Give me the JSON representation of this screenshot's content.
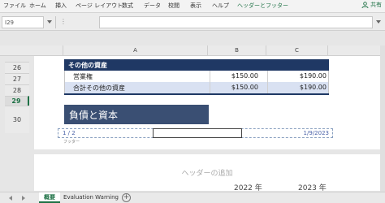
{
  "ribbon": {
    "tabs": [
      "ファイル",
      "ホーム",
      "挿入",
      "ページ レイアウト",
      "数式",
      "データ",
      "校閲",
      "表示",
      "ヘルプ",
      "ヘッダーとフッター"
    ],
    "active_tab": "ヘッダーとフッター",
    "share_label": "共有"
  },
  "formula_bar": {
    "name_box": "I29",
    "formula": ""
  },
  "columns": [
    "A",
    "B",
    "C"
  ],
  "rows": [
    "26",
    "27",
    "28",
    "29",
    "30"
  ],
  "selected_row": "29",
  "table": {
    "header": "その他の資産",
    "rows": [
      {
        "label": "営業権",
        "b": "$150.00",
        "c": "$190.00"
      },
      {
        "label": "合計その他の資産",
        "b": "$150.00",
        "c": "$190.00"
      }
    ]
  },
  "section_title": "負債と資本",
  "footer": {
    "left": "1 / 2",
    "right": "1/9/2023",
    "label": "フッター"
  },
  "next_page": {
    "header_placeholder": "ヘッダーの追加",
    "year1": "2022 年",
    "year2": "2023 年"
  },
  "sheets": [
    "概要",
    "Evaluation Warning"
  ],
  "active_sheet": "概要",
  "colors": {
    "accent": "#1e7145",
    "table_header": "#1f3864",
    "section_title": "#3a4f73",
    "alt_row": "#d9e1f2"
  }
}
